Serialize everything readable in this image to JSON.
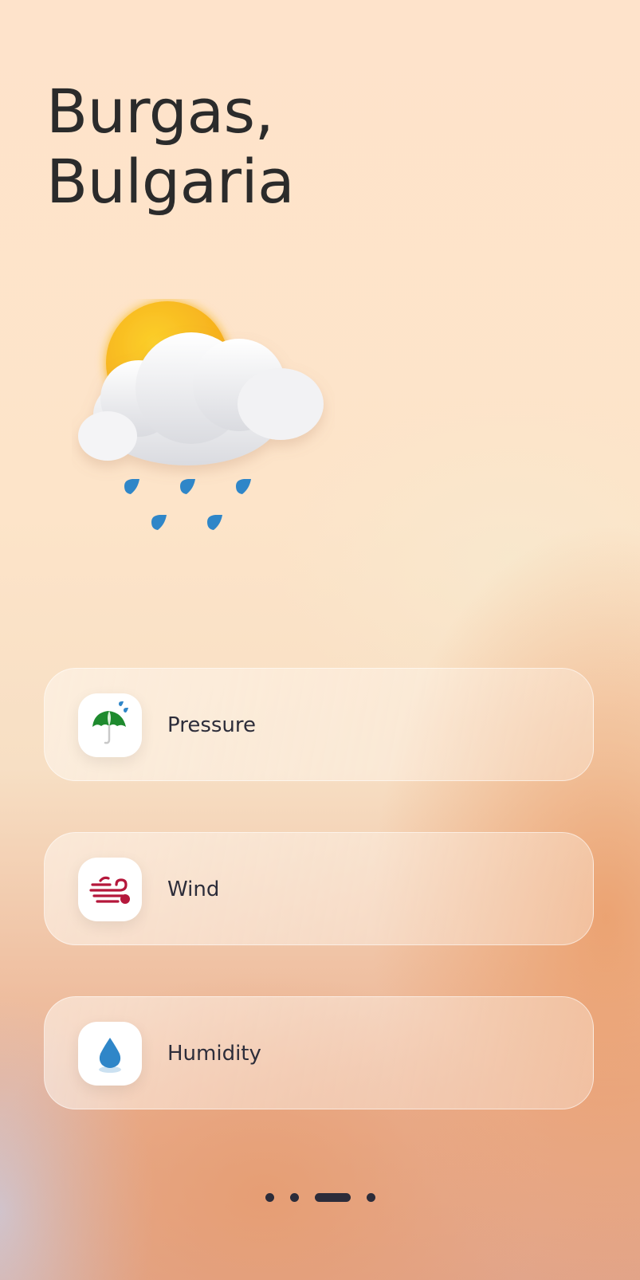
{
  "location": {
    "city": "Burgas,",
    "country": "Bulgaria"
  },
  "hero_icon": "sun-behind-rain-cloud-icon",
  "cards": [
    {
      "label": "Pressure",
      "icon": "umbrella-rain-icon"
    },
    {
      "label": "Wind",
      "icon": "wind-icon"
    },
    {
      "label": "Humidity",
      "icon": "water-drop-icon"
    }
  ],
  "pager": {
    "total": 4,
    "active_index": 2
  },
  "colors": {
    "title": "#2b2b2b",
    "label": "#2d2d3a",
    "sun": "#f9b91c",
    "rain": "#2f86c8",
    "umbrella": "#1e8a2e",
    "wind": "#b5173b"
  }
}
